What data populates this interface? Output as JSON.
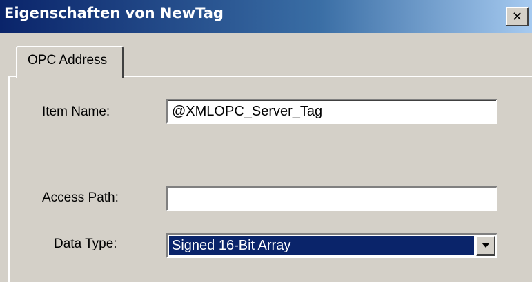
{
  "window": {
    "title": "Eigenschaften von NewTag"
  },
  "tabs": [
    {
      "label": "OPC Address"
    }
  ],
  "form": {
    "item_name": {
      "label": "Item Name:",
      "value": "@XMLOPC_Server_Tag"
    },
    "access_path": {
      "label": "Access Path:",
      "value": ""
    },
    "data_type": {
      "label": "Data Type:",
      "selected": "Signed 16-Bit Array"
    }
  },
  "icons": {
    "close": "close-icon",
    "dropdown": "chevron-down-icon"
  },
  "colors": {
    "titlebar": "#0a246a",
    "selection": "#0a246a",
    "face": "#d4d0c8"
  }
}
